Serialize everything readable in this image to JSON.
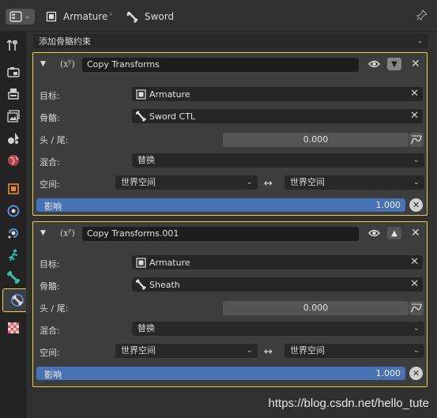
{
  "header": {
    "object_name": "Armature",
    "bone_name": "Sword"
  },
  "add_constraint": "添加骨骼约束",
  "constraints": [
    {
      "name": "Copy Transforms",
      "target_label": "目标:",
      "target": "Armature",
      "bone_label": "骨骼:",
      "bone": "Sword CTL",
      "head_tail_label": "头 / 尾:",
      "head_tail": "0.000",
      "mix_label": "混合:",
      "mix": "替换",
      "space_label": "空间:",
      "owner_space": "世界空间",
      "target_space": "世界空间",
      "influence_label": "影响",
      "influence": "1.000",
      "move_direction": "down"
    },
    {
      "name": "Copy Transforms.001",
      "target_label": "目标:",
      "target": "Armature",
      "bone_label": "骨骼:",
      "bone": "Sheath",
      "head_tail_label": "头 / 尾:",
      "head_tail": "0.000",
      "mix_label": "混合:",
      "mix": "替换",
      "space_label": "空间:",
      "owner_space": "世界空间",
      "target_space": "世界空间",
      "influence_label": "影响",
      "influence": "1.000",
      "move_direction": "up"
    }
  ],
  "sidebar_tabs": [
    "tool-icon",
    "render-icon",
    "output-icon",
    "view-layer-icon",
    "scene-icon",
    "world-icon",
    "object-icon",
    "modifiers-icon",
    "particles-icon",
    "physics-icon",
    "bone-icon",
    "bone-constraint-icon",
    "texture-icon"
  ],
  "watermark": "https://blog.csdn.net/hello_tute",
  "colors": {
    "accent_outline": "#e7d33b",
    "influence_bar": "#4772b3",
    "panel_bg": "#3d3d3d"
  }
}
